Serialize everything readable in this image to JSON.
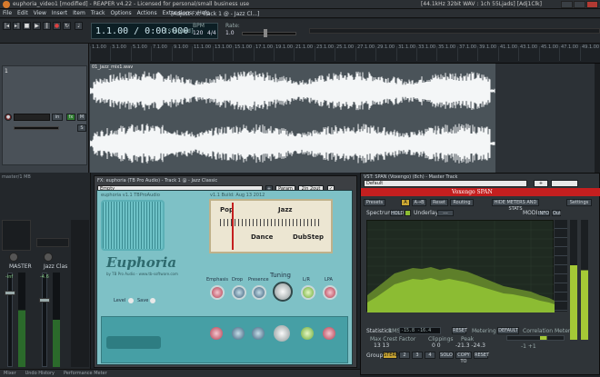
{
  "window": {
    "title": "euphoria_video1 [modified] - REAPER v4.22 - Licensed for personal/small business use",
    "audio_info": "[44.1kHz 32bit WAV : 1ch 55Ljads]",
    "engine_info": "[Adj1Clk]"
  },
  "menu": {
    "items": [
      "File",
      "Edit",
      "View",
      "Insert",
      "Item",
      "Track",
      "Options",
      "Actions",
      "Extensions",
      "Help"
    ],
    "info": "[Adjust FX: Track 1 @ - Jazz Cl...]"
  },
  "transport": {
    "time": "1.1.00 / 0:00.000",
    "status": "[Stopped]",
    "bpm_label": "BPM",
    "bpm": "120",
    "rate_label": "Rate:",
    "rate": "1.0",
    "sig": "4/4"
  },
  "ruler": {
    "labels": [
      "1.1.00",
      "3.1.00",
      "5.1.00",
      "7.1.00",
      "9.1.00",
      "11.1.00",
      "13.1.00",
      "15.1.00",
      "17.1.00",
      "19.1.00",
      "21.1.00",
      "23.1.00",
      "25.1.00",
      "27.1.00",
      "29.1.00",
      "31.1.00",
      "33.1.00",
      "35.1.00",
      "37.1.00",
      "39.1.00",
      "41.1.00",
      "43.1.00",
      "45.1.00",
      "47.1.00",
      "49.1.00"
    ]
  },
  "track": {
    "number": "1",
    "item_name": "01_jazz_mix1.wav",
    "io_label": "in"
  },
  "mixer": {
    "master_label": "MASTER",
    "track_label": "Jazz Clas",
    "bottom_tabs": [
      "Mixer",
      "Undo History"
    ],
    "master_db": "-inf",
    "track_db": "-4.6"
  },
  "plugin": {
    "window_title": "FX: euphoria (TB Pro Audio) - Track 1 @ - Jazz Classic",
    "preset": "Empty",
    "buttons": {
      "param": "Param",
      "io": "2in 2out"
    },
    "brand": "Euphoria",
    "brand_sub": "by TB Pro Audio - www.tb-software.com",
    "brand_top": "euphoria v1.1 TBProAudio",
    "scale_version": "v1.1 Build: Aug 13 2012",
    "labels": [
      "Pop",
      "Jazz",
      "Dance",
      "DubStep"
    ],
    "controls": [
      "Emphasis",
      "Drop",
      "Presence",
      "Tuning",
      "L/R",
      "LPA"
    ],
    "level_label": "Level",
    "save_label": "Save"
  },
  "span": {
    "window_title": "VST: SPAN (Voxengo) (8ch) - Master Track",
    "preset": "Default",
    "brand": "Voxengo SPAN",
    "buttons": {
      "presets": "Presets",
      "ab1": "A",
      "ab2": "A→B",
      "reset": "Reset",
      "routing": "Routing",
      "meter_toggle": "HIDE METERS AND STATS",
      "settings": "Settings",
      "hold": "HOLD",
      "underlay": "Underlay",
      "mode": "MODE",
      "mode_btn": "INFO",
      "out": "Out"
    },
    "section_label": "Spectrum",
    "plus": "Plus",
    "bypass": "Bypass",
    "hint": "1/25s"
  },
  "stats": {
    "statistics_label": "Statistics",
    "rms_label": "RMS",
    "rms": "-15.8 -16.4",
    "reset_label": "RESET",
    "metering_label": "Metering",
    "metering_value": "DEFAULT",
    "max_crest_label": "Max Crest Factor",
    "max_crest_value": "13 13",
    "clippings_label": "Clippings",
    "clippings_value": "0 0",
    "peak_label": "Peak",
    "peak_value": "-21.3 -24.3",
    "correlation_label": "Correlation Meter",
    "group_label": "Group",
    "groups": [
      "STEREO",
      "2",
      "3",
      "4",
      "SOLO",
      "COPY TO",
      "RESET"
    ],
    "corr_values": "-1 +1"
  },
  "statusbar": {
    "items": [
      "Mixer",
      "Undo History",
      "Performance Meter"
    ]
  },
  "colors": {
    "accent_red": "#c41f1f",
    "spectrum_green": "#8cbc33",
    "euphoria_teal": "#7ec1c6"
  }
}
